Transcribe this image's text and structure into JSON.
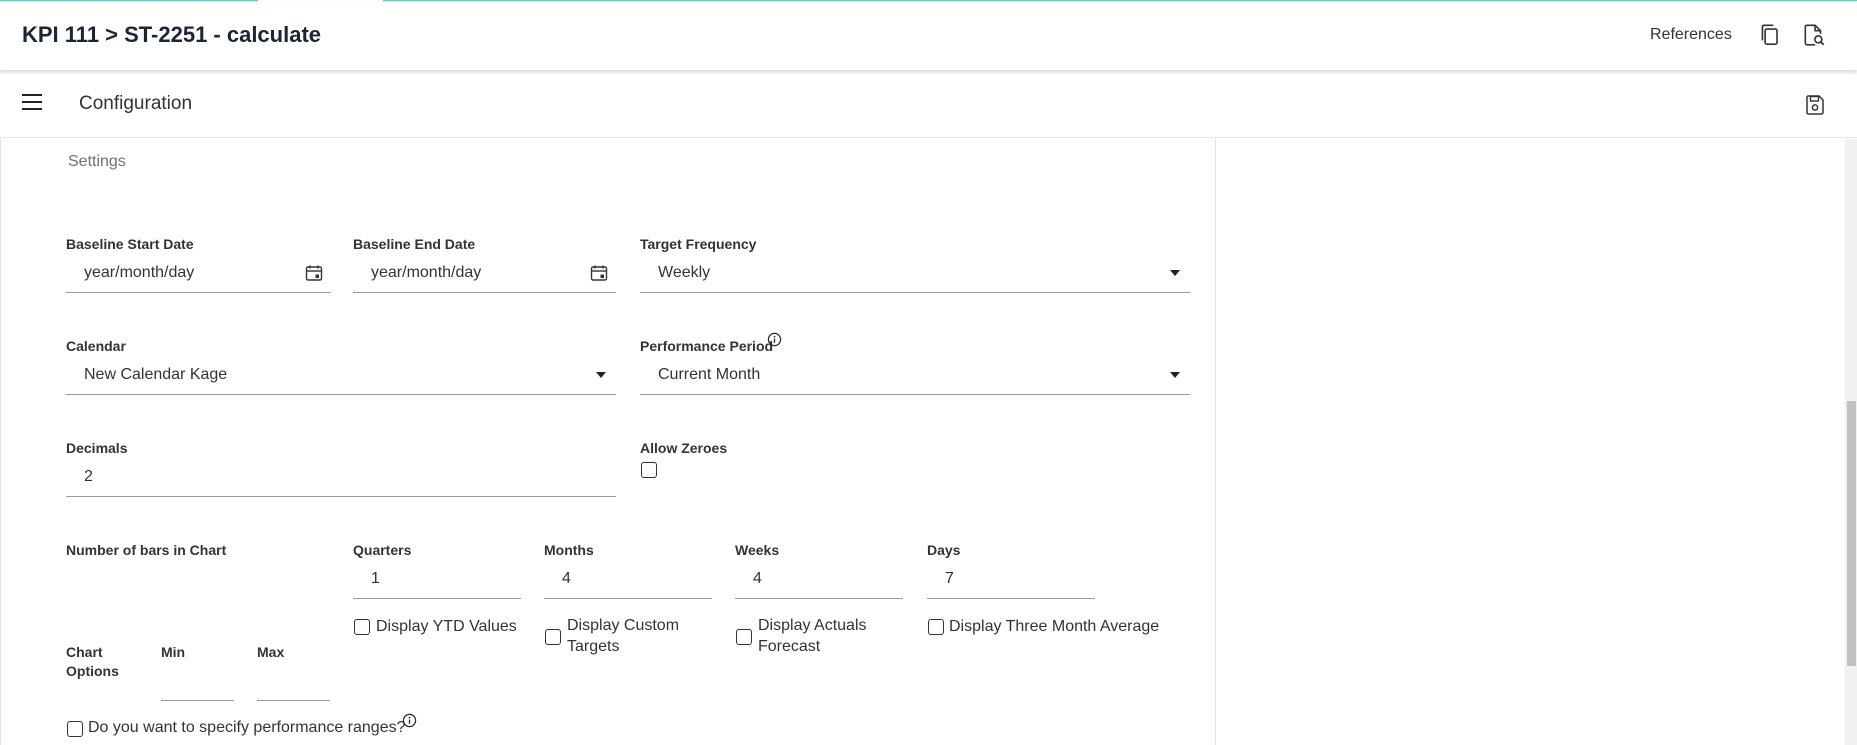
{
  "header": {
    "title": "KPI 111 > ST-2251 - calculate",
    "references_label": "References",
    "icons": [
      "copy-icon",
      "document-search-icon"
    ]
  },
  "subheader": {
    "title": "Configuration",
    "icons": [
      "menu-icon",
      "save-icon"
    ]
  },
  "settings": {
    "section_title": "Settings",
    "baseline_start": {
      "label": "Baseline Start Date",
      "value": "year/month/day"
    },
    "baseline_end": {
      "label": "Baseline End Date",
      "value": "year/month/day"
    },
    "target_frequency": {
      "label": "Target Frequency",
      "value": "Weekly"
    },
    "calendar": {
      "label": "Calendar",
      "value": "New Calendar Kage"
    },
    "performance_period": {
      "label": "Performance Period",
      "value": "Current Month"
    },
    "decimals": {
      "label": "Decimals",
      "value": "2"
    },
    "allow_zeroes": {
      "label": "Allow Zeroes",
      "checked": false
    },
    "bars": {
      "label": "Number of bars in Chart",
      "quarters": {
        "label": "Quarters",
        "value": "1"
      },
      "months": {
        "label": "Months",
        "value": "4"
      },
      "weeks": {
        "label": "Weeks",
        "value": "4"
      },
      "days": {
        "label": "Days",
        "value": "7"
      }
    },
    "checkboxes": {
      "ytd": {
        "label": "Display YTD Values",
        "checked": false
      },
      "custom_targets": {
        "label_line1": "Display Custom",
        "label_line2": "Targets",
        "checked": false
      },
      "actuals_forecast": {
        "label_line1": "Display Actuals",
        "label_line2": "Forecast",
        "checked": false
      },
      "three_month": {
        "label": "Display Three Month Average",
        "checked": false
      }
    },
    "chart_options": {
      "label_line1": "Chart",
      "label_line2": "Options",
      "min_label": "Min",
      "max_label": "Max",
      "min_value": "",
      "max_value": ""
    },
    "performance_ranges": {
      "label": "Do you want to specify performance ranges?",
      "checked": false
    }
  },
  "colors": {
    "accent": "#6cc5bd",
    "text": "#333333",
    "title": "#1d2433"
  }
}
